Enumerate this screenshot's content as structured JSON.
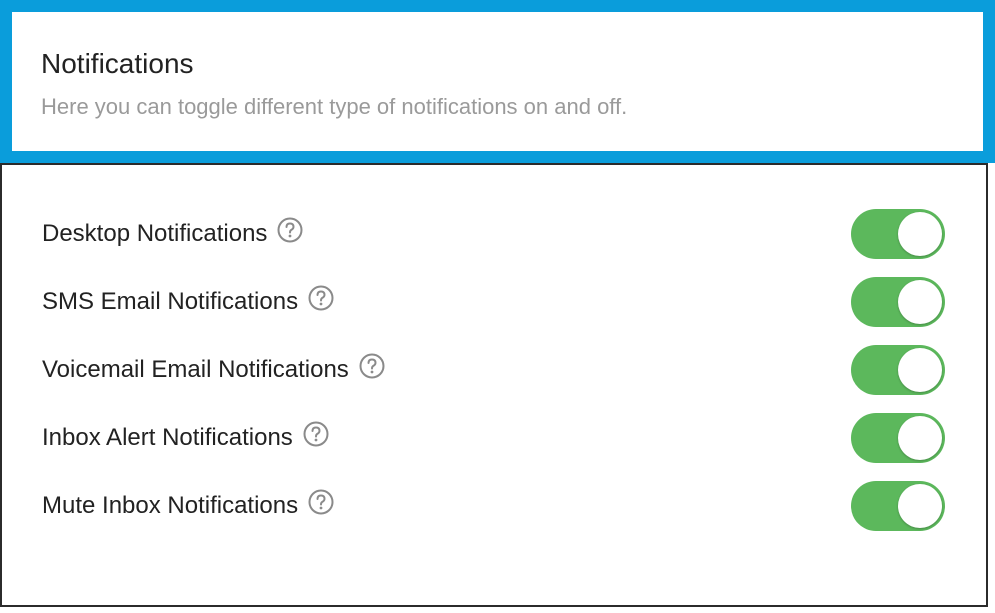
{
  "header": {
    "title": "Notifications",
    "subtitle": "Here you can toggle different type of notifications on and off."
  },
  "settings": [
    {
      "label": "Desktop Notifications",
      "enabled": true
    },
    {
      "label": "SMS Email Notifications",
      "enabled": true
    },
    {
      "label": "Voicemail Email Notifications",
      "enabled": true
    },
    {
      "label": "Inbox Alert Notifications",
      "enabled": true
    },
    {
      "label": "Mute Inbox Notifications",
      "enabled": true
    }
  ],
  "icons": {
    "help": "question-circle-icon"
  },
  "colors": {
    "header_border": "#0a9ddb",
    "toggle_on": "#5cb85c",
    "title_text": "#222222",
    "subtitle_text": "#9a9a9a",
    "help_icon": "#8a8a8a"
  }
}
